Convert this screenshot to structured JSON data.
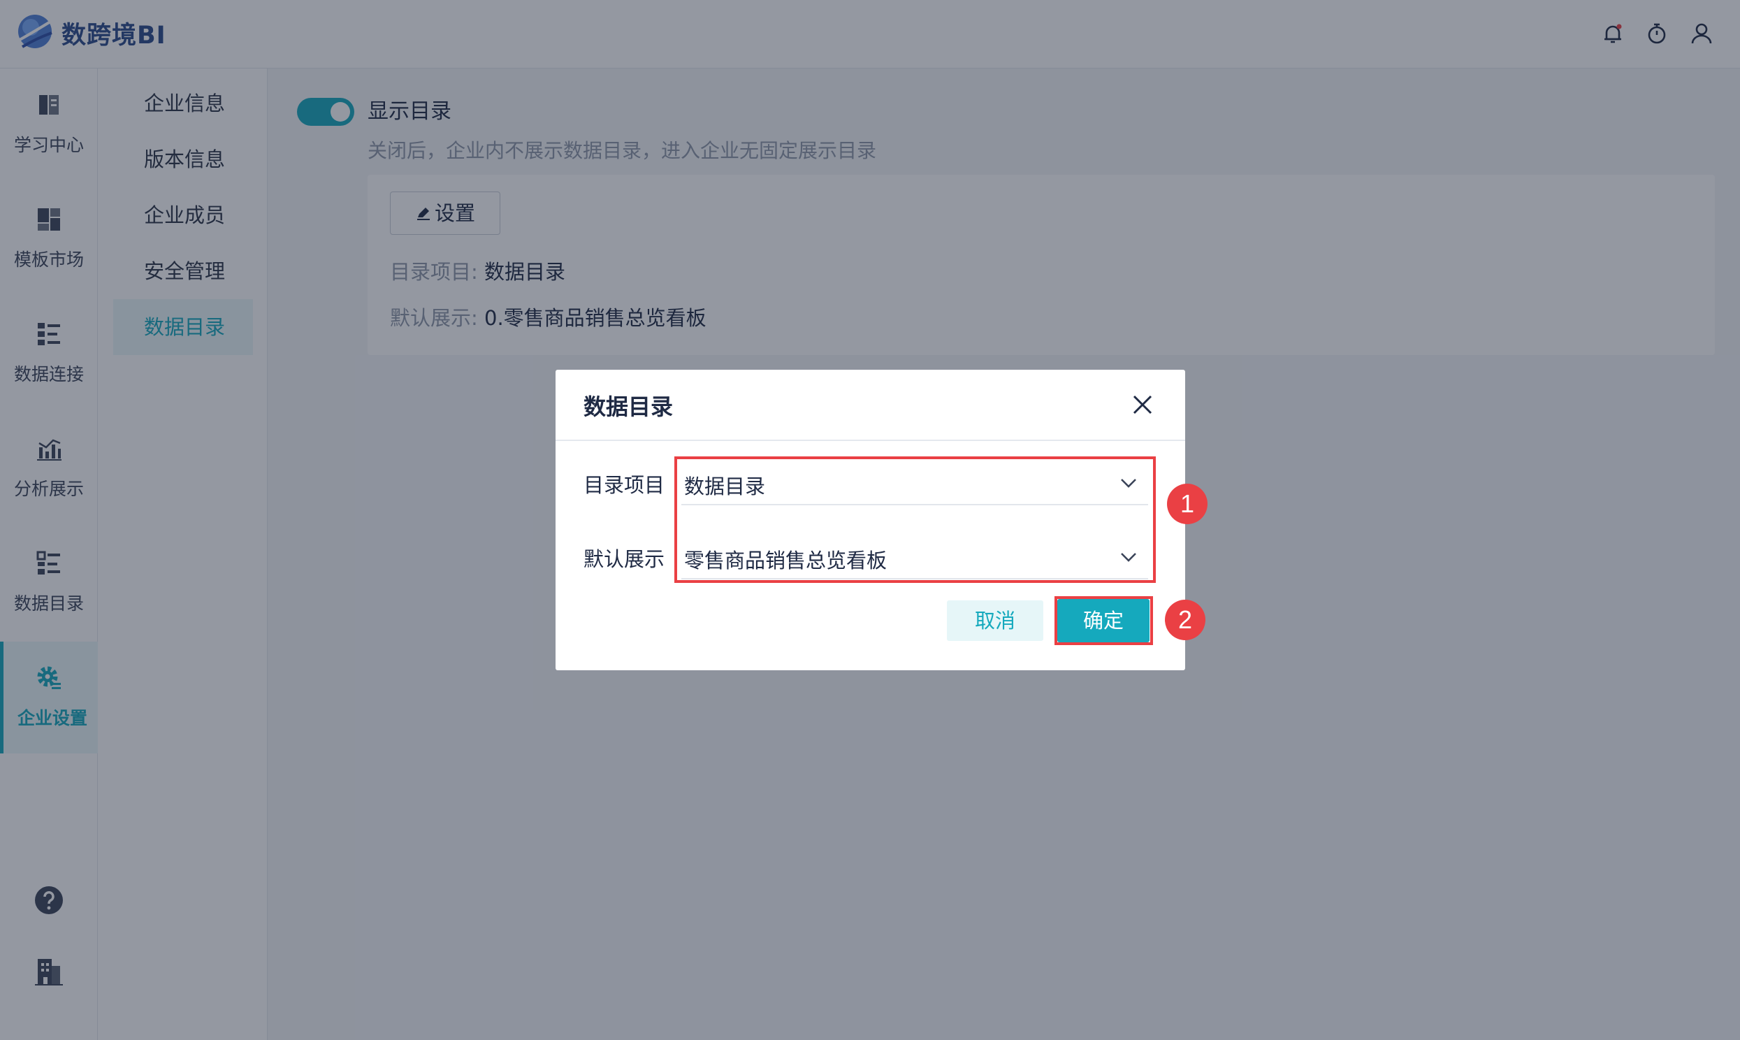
{
  "header": {
    "brand": "数跨境BI",
    "icons": [
      "bell-icon",
      "stopwatch-icon",
      "user-icon"
    ]
  },
  "rail": {
    "items": [
      {
        "label": "学习中心",
        "icon": "book-icon"
      },
      {
        "label": "模板市场",
        "icon": "layout-icon"
      },
      {
        "label": "数据连接",
        "icon": "connection-icon"
      },
      {
        "label": "分析展示",
        "icon": "bar-chart-icon"
      },
      {
        "label": "数据目录",
        "icon": "list-icon"
      },
      {
        "label": "企业设置",
        "icon": "gear-icon"
      }
    ],
    "active": "企业设置",
    "footer_icons": [
      "help-icon",
      "building-icon"
    ]
  },
  "submenu": {
    "items": [
      "企业信息",
      "版本信息",
      "企业成员",
      "安全管理",
      "数据目录"
    ],
    "active": "数据目录"
  },
  "main": {
    "toggle": {
      "label": "显示目录",
      "on": true
    },
    "description": "关闭后，企业内不展示数据目录，进入企业无固定展示目录",
    "settings_button": "设置",
    "catalog_key": "目录项目:",
    "catalog_value": "数据目录",
    "default_key": "默认展示:",
    "default_value": "0.零售商品销售总览看板"
  },
  "dialog": {
    "title": "数据目录",
    "fields": [
      {
        "label": "目录项目",
        "value": "数据目录"
      },
      {
        "label": "默认展示",
        "value": "零售商品销售总览看板"
      }
    ],
    "cancel_label": "取消",
    "ok_label": "确定",
    "annotations": [
      "1",
      "2"
    ]
  },
  "colors": {
    "accent": "#15a9bd",
    "highlight": "#ea4044",
    "mask": "rgba(28,36,56,0.47)"
  }
}
